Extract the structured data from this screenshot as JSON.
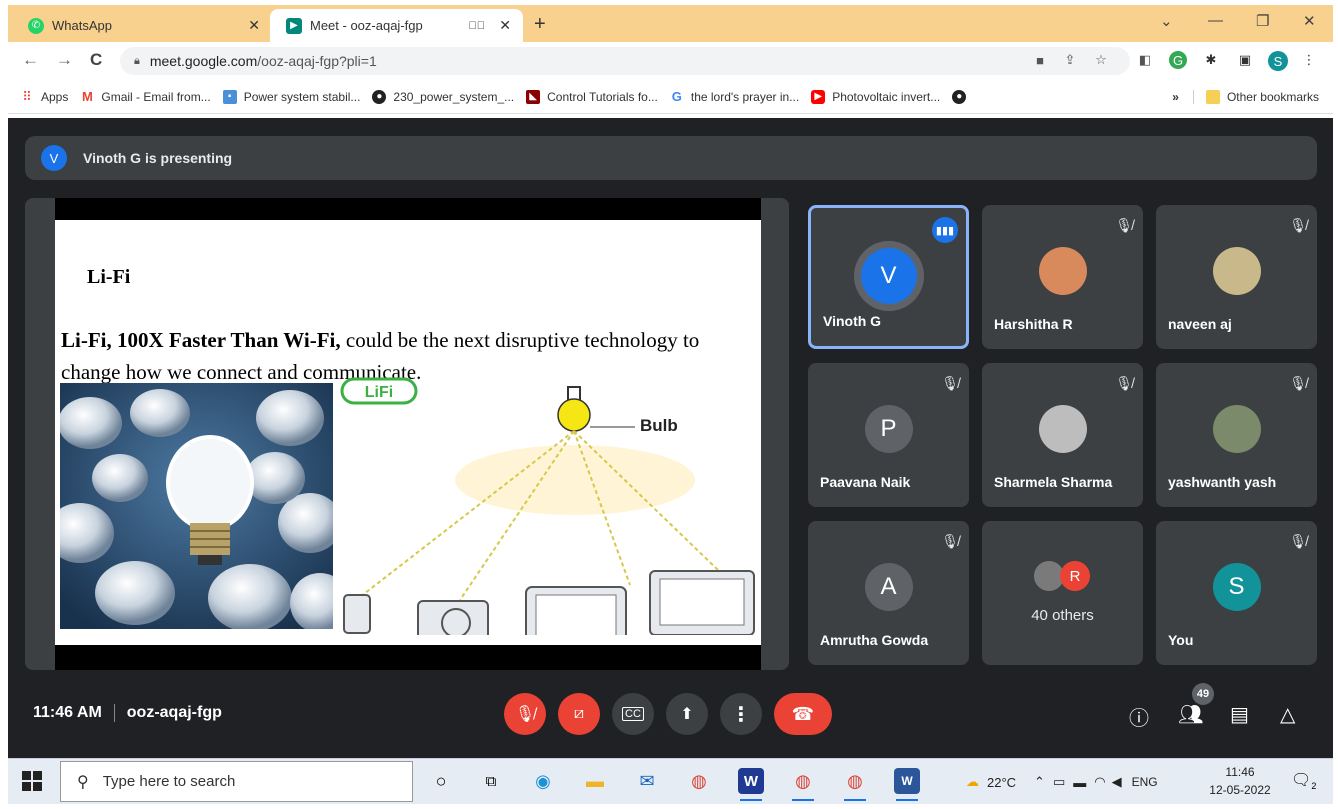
{
  "browser": {
    "tabs": [
      {
        "title": "WhatsApp",
        "active": false
      },
      {
        "title": "Meet - ooz-aqaj-fgp",
        "active": true
      }
    ],
    "url_domain": "meet.google.com",
    "url_path": "/ooz-aqaj-fgp?pli=1",
    "profile_initial": "S",
    "bookmarks": [
      {
        "label": "Apps",
        "icon": "apps-grid-icon"
      },
      {
        "label": "Gmail - Email from...",
        "icon": "gmail-icon"
      },
      {
        "label": "Power system stabil...",
        "icon": "page-icon"
      },
      {
        "label": "230_power_system_...",
        "icon": "github-icon"
      },
      {
        "label": "Control Tutorials fo...",
        "icon": "page-icon"
      },
      {
        "label": "the lord's prayer in...",
        "icon": "google-icon"
      },
      {
        "label": "Photovoltaic invert...",
        "icon": "youtube-icon"
      }
    ],
    "more_bookmarks": "»",
    "other_bookmarks": "Other bookmarks"
  },
  "meet": {
    "presenter_initial": "V",
    "presenting_text": "Vinoth G is presenting",
    "slide": {
      "title": "Li-Fi",
      "body_bold": "Li-Fi, 100X Faster Than Wi-Fi,",
      "body_rest": " could be the next disruptive technology to change how we connect and communicate.",
      "logo_text": "LiFi",
      "bulb_label": "Bulb"
    },
    "participants": [
      {
        "name": "Vinoth G",
        "initial": "V",
        "color": "#1a73e8",
        "speaking": true,
        "muted": false
      },
      {
        "name": "Harshitha R",
        "initial": "",
        "color": "#d98a5c",
        "speaking": false,
        "muted": true
      },
      {
        "name": "naveen aj",
        "initial": "",
        "color": "#c9b98a",
        "speaking": false,
        "muted": true
      },
      {
        "name": "Paavana Naik",
        "initial": "P",
        "color": "#5f6368",
        "speaking": false,
        "muted": true
      },
      {
        "name": "Sharmela Sharma",
        "initial": "",
        "color": "#bdbdbd",
        "speaking": false,
        "muted": true
      },
      {
        "name": "yashwanth yash",
        "initial": "",
        "color": "#7a8a6a",
        "speaking": false,
        "muted": true
      },
      {
        "name": "Amrutha Gowda",
        "initial": "A",
        "color": "#5f6368",
        "speaking": false,
        "muted": true
      },
      {
        "name": "",
        "initial": "R",
        "color": "#ea4335",
        "others_label": "40 others",
        "speaking": false,
        "muted": false
      },
      {
        "name": "You",
        "initial": "S",
        "color": "#12939a",
        "speaking": false,
        "muted": true
      }
    ],
    "time": "11:46 AM",
    "meeting_code": "ooz-aqaj-fgp",
    "people_count": "49"
  },
  "taskbar": {
    "search_placeholder": "Type here to search",
    "temperature": "22°C",
    "language": "ENG",
    "clock_time": "11:46",
    "clock_date": "12-05-2022",
    "notification_count": "2"
  }
}
